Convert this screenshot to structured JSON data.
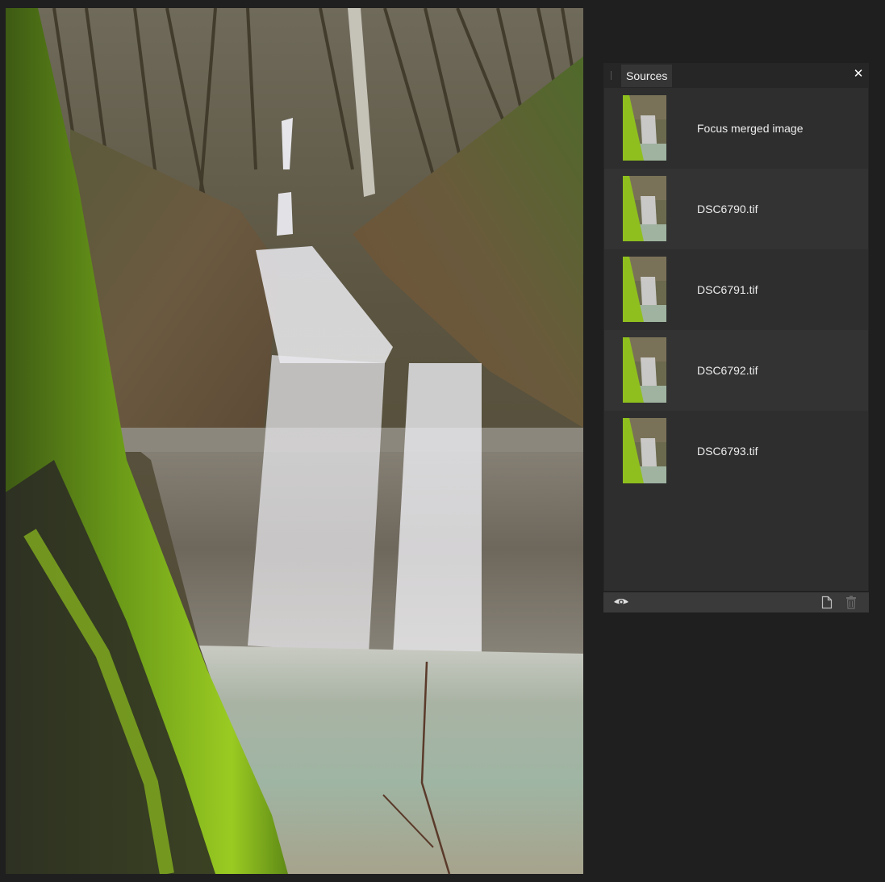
{
  "canvas": {
    "image_description": "Long-exposure photo of a multi-tier forest waterfall with a moss-covered tree trunk in the foreground and a turquoise pool at the bottom"
  },
  "sources_panel": {
    "tab_label": "Sources",
    "close_icon": "close-icon",
    "items": [
      {
        "label": "Focus merged image",
        "thumbnail": "waterfall-thumbnail"
      },
      {
        "label": "DSC6790.tif",
        "thumbnail": "waterfall-thumbnail"
      },
      {
        "label": "DSC6791.tif",
        "thumbnail": "waterfall-thumbnail"
      },
      {
        "label": "DSC6792.tif",
        "thumbnail": "waterfall-thumbnail"
      },
      {
        "label": "DSC6793.tif",
        "thumbnail": "waterfall-thumbnail"
      }
    ],
    "footer": {
      "visibility_icon": "eye-icon",
      "new_icon": "new-document-icon",
      "delete_icon": "trash-icon"
    }
  },
  "colors": {
    "app_background": "#1f1f1f",
    "panel_background": "#262626",
    "row_background": "#2e2e2e",
    "row_alt_background": "#333333",
    "footer_background": "#3a3a3a",
    "moss_green": "#8fbf1e"
  }
}
